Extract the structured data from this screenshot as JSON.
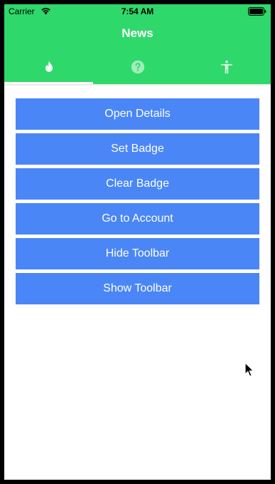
{
  "status_bar": {
    "carrier": "Carrier",
    "time": "7:54 AM",
    "wifi_icon": "wifi-icon",
    "battery_icon": "battery-icon"
  },
  "nav": {
    "title": "News"
  },
  "tabs": [
    {
      "icon": "flame-icon",
      "selected": true
    },
    {
      "icon": "question-circle-icon",
      "selected": false
    },
    {
      "icon": "accessibility-icon",
      "selected": false
    }
  ],
  "buttons": [
    {
      "label": "Open Details"
    },
    {
      "label": "Set Badge"
    },
    {
      "label": "Clear Badge"
    },
    {
      "label": "Go to Account"
    },
    {
      "label": "Hide Toolbar"
    },
    {
      "label": "Show Toolbar"
    }
  ],
  "colors": {
    "accent_green": "#2fd86a",
    "button_blue": "#4a86f6",
    "text_white": "#ffffff"
  }
}
